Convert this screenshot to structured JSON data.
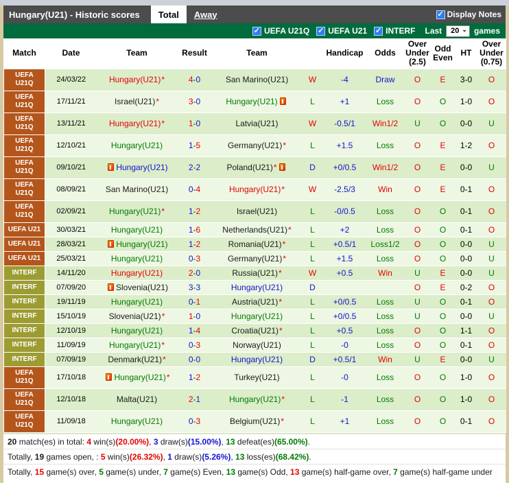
{
  "header": {
    "title": "Hungary(U21) - Historic scores",
    "tabs": [
      {
        "label": "Total",
        "active": true
      },
      {
        "label": "Away",
        "active": false
      }
    ],
    "display_notes_label": "Display Notes",
    "display_notes_checked": true
  },
  "filter_bar": {
    "checkboxes": [
      {
        "label": "UEFA U21Q",
        "checked": true
      },
      {
        "label": "UEFA U21",
        "checked": true
      },
      {
        "label": "INTERF",
        "checked": true
      }
    ],
    "last_label": "Last",
    "games_count": "20",
    "games_label": "games"
  },
  "colors": {
    "win_red": "#e60000",
    "loss_green": "#007a00",
    "draw_blue": "#1414cc",
    "uefa_label_bg": "#b4561c",
    "interf_label_bg": "#9c9c33",
    "filter_bar_green": "#006b3c",
    "title_bar_gray": "#4c4c4c"
  },
  "table": {
    "columns": [
      "Match",
      "Date",
      "Team",
      "Result",
      "Team",
      "",
      "Handicap",
      "Odds",
      "Over Under (2.5)",
      "Odd Even",
      "HT",
      "Over Under (0.75)"
    ],
    "rows": [
      {
        "comp": "UEFA U21Q",
        "type": "uefaq",
        "date": "24/03/22",
        "t1": {
          "n": "Hungary(U21)",
          "c": "red",
          "star": true,
          "note": ""
        },
        "s1": "4",
        "c1": "red",
        "s2": "0",
        "c2": "blue",
        "t2": {
          "n": "San Marino(U21)",
          "c": "black",
          "star": false,
          "note": ""
        },
        "wld": "W",
        "wldc": "red",
        "hc": "-4",
        "odds": "Draw",
        "oddsc": "blue",
        "ou": "O",
        "ouc": "red",
        "oe": "E",
        "oec": "red",
        "ht": "3-0",
        "ou75": "O",
        "ou75c": "red"
      },
      {
        "comp": "UEFA U21Q",
        "type": "uefaq",
        "date": "17/11/21",
        "t1": {
          "n": "Israel(U21)",
          "c": "black",
          "star": true,
          "note": ""
        },
        "s1": "3",
        "c1": "red",
        "s2": "0",
        "c2": "blue",
        "t2": {
          "n": "Hungary(U21)",
          "c": "green",
          "star": false,
          "note": "after"
        },
        "wld": "L",
        "wldc": "green",
        "hc": "+1",
        "odds": "Loss",
        "oddsc": "green",
        "ou": "O",
        "ouc": "red",
        "oe": "O",
        "oec": "green",
        "ht": "1-0",
        "ou75": "O",
        "ou75c": "red"
      },
      {
        "comp": "UEFA U21Q",
        "type": "uefaq",
        "date": "13/11/21",
        "t1": {
          "n": "Hungary(U21)",
          "c": "red",
          "star": true,
          "note": ""
        },
        "s1": "1",
        "c1": "red",
        "s2": "0",
        "c2": "blue",
        "t2": {
          "n": "Latvia(U21)",
          "c": "black",
          "star": false,
          "note": ""
        },
        "wld": "W",
        "wldc": "red",
        "hc": "-0.5/1",
        "odds": "Win1/2",
        "oddsc": "red",
        "ou": "U",
        "ouc": "green",
        "oe": "O",
        "oec": "green",
        "ht": "0-0",
        "ou75": "U",
        "ou75c": "green"
      },
      {
        "comp": "UEFA U21Q",
        "type": "uefaq",
        "date": "12/10/21",
        "t1": {
          "n": "Hungary(U21)",
          "c": "green",
          "star": false,
          "note": ""
        },
        "s1": "1",
        "c1": "blue",
        "s2": "5",
        "c2": "red",
        "t2": {
          "n": "Germany(U21)",
          "c": "black",
          "star": true,
          "note": ""
        },
        "wld": "L",
        "wldc": "green",
        "hc": "+1.5",
        "odds": "Loss",
        "oddsc": "green",
        "ou": "O",
        "ouc": "red",
        "oe": "E",
        "oec": "red",
        "ht": "1-2",
        "ou75": "O",
        "ou75c": "red"
      },
      {
        "comp": "UEFA U21Q",
        "type": "uefaq",
        "date": "09/10/21",
        "t1": {
          "n": "Hungary(U21)",
          "c": "blue",
          "star": false,
          "note": "before"
        },
        "s1": "2",
        "c1": "blue",
        "s2": "2",
        "c2": "blue",
        "t2": {
          "n": "Poland(U21)",
          "c": "black",
          "star": true,
          "note": "after"
        },
        "wld": "D",
        "wldc": "blue",
        "hc": "+0/0.5",
        "odds": "Win1/2",
        "oddsc": "red",
        "ou": "O",
        "ouc": "red",
        "oe": "E",
        "oec": "red",
        "ht": "0-0",
        "ou75": "U",
        "ou75c": "green"
      },
      {
        "comp": "UEFA U21Q",
        "type": "uefaq",
        "date": "08/09/21",
        "t1": {
          "n": "San Marino(U21)",
          "c": "black",
          "star": false,
          "note": ""
        },
        "s1": "0",
        "c1": "blue",
        "s2": "4",
        "c2": "red",
        "t2": {
          "n": "Hungary(U21)",
          "c": "red",
          "star": true,
          "note": ""
        },
        "wld": "W",
        "wldc": "red",
        "hc": "-2.5/3",
        "odds": "Win",
        "oddsc": "red",
        "ou": "O",
        "ouc": "red",
        "oe": "E",
        "oec": "red",
        "ht": "0-1",
        "ou75": "O",
        "ou75c": "red"
      },
      {
        "comp": "UEFA U21Q",
        "type": "uefaq",
        "date": "02/09/21",
        "t1": {
          "n": "Hungary(U21)",
          "c": "green",
          "star": true,
          "note": ""
        },
        "s1": "1",
        "c1": "blue",
        "s2": "2",
        "c2": "red",
        "t2": {
          "n": "Israel(U21)",
          "c": "black",
          "star": false,
          "note": ""
        },
        "wld": "L",
        "wldc": "green",
        "hc": "-0/0.5",
        "odds": "Loss",
        "oddsc": "green",
        "ou": "O",
        "ouc": "red",
        "oe": "O",
        "oec": "green",
        "ht": "0-1",
        "ou75": "O",
        "ou75c": "red"
      },
      {
        "comp": "UEFA U21",
        "type": "u21",
        "date": "30/03/21",
        "t1": {
          "n": "Hungary(U21)",
          "c": "green",
          "star": false,
          "note": ""
        },
        "s1": "1",
        "c1": "blue",
        "s2": "6",
        "c2": "red",
        "t2": {
          "n": "Netherlands(U21)",
          "c": "black",
          "star": true,
          "note": ""
        },
        "wld": "L",
        "wldc": "green",
        "hc": "+2",
        "odds": "Loss",
        "oddsc": "green",
        "ou": "O",
        "ouc": "red",
        "oe": "O",
        "oec": "green",
        "ht": "0-1",
        "ou75": "O",
        "ou75c": "red"
      },
      {
        "comp": "UEFA U21",
        "type": "u21",
        "date": "28/03/21",
        "t1": {
          "n": "Hungary(U21)",
          "c": "green",
          "star": false,
          "note": "before"
        },
        "s1": "1",
        "c1": "blue",
        "s2": "2",
        "c2": "red",
        "t2": {
          "n": "Romania(U21)",
          "c": "black",
          "star": true,
          "note": ""
        },
        "wld": "L",
        "wldc": "green",
        "hc": "+0.5/1",
        "odds": "Loss1/2",
        "oddsc": "green",
        "ou": "O",
        "ouc": "red",
        "oe": "O",
        "oec": "green",
        "ht": "0-0",
        "ou75": "U",
        "ou75c": "green"
      },
      {
        "comp": "UEFA U21",
        "type": "u21",
        "date": "25/03/21",
        "t1": {
          "n": "Hungary(U21)",
          "c": "green",
          "star": false,
          "note": ""
        },
        "s1": "0",
        "c1": "blue",
        "s2": "3",
        "c2": "red",
        "t2": {
          "n": "Germany(U21)",
          "c": "black",
          "star": true,
          "note": ""
        },
        "wld": "L",
        "wldc": "green",
        "hc": "+1.5",
        "odds": "Loss",
        "oddsc": "green",
        "ou": "O",
        "ouc": "red",
        "oe": "O",
        "oec": "green",
        "ht": "0-0",
        "ou75": "U",
        "ou75c": "green"
      },
      {
        "comp": "INTERF",
        "type": "interf",
        "date": "14/11/20",
        "t1": {
          "n": "Hungary(U21)",
          "c": "red",
          "star": false,
          "note": ""
        },
        "s1": "2",
        "c1": "red",
        "s2": "0",
        "c2": "blue",
        "t2": {
          "n": "Russia(U21)",
          "c": "black",
          "star": true,
          "note": ""
        },
        "wld": "W",
        "wldc": "red",
        "hc": "+0.5",
        "odds": "Win",
        "oddsc": "red",
        "ou": "U",
        "ouc": "green",
        "oe": "E",
        "oec": "red",
        "ht": "0-0",
        "ou75": "U",
        "ou75c": "green"
      },
      {
        "comp": "INTERF",
        "type": "interf",
        "date": "07/09/20",
        "t1": {
          "n": "Slovenia(U21)",
          "c": "black",
          "star": false,
          "note": "before"
        },
        "s1": "3",
        "c1": "blue",
        "s2": "3",
        "c2": "blue",
        "t2": {
          "n": "Hungary(U21)",
          "c": "blue",
          "star": false,
          "note": ""
        },
        "wld": "D",
        "wldc": "blue",
        "hc": "",
        "odds": "",
        "oddsc": "black",
        "ou": "O",
        "ouc": "red",
        "oe": "E",
        "oec": "red",
        "ht": "0-2",
        "ou75": "O",
        "ou75c": "red"
      },
      {
        "comp": "INTERF",
        "type": "interf",
        "date": "19/11/19",
        "t1": {
          "n": "Hungary(U21)",
          "c": "green",
          "star": false,
          "note": ""
        },
        "s1": "0",
        "c1": "blue",
        "s2": "1",
        "c2": "red",
        "t2": {
          "n": "Austria(U21)",
          "c": "black",
          "star": true,
          "note": ""
        },
        "wld": "L",
        "wldc": "green",
        "hc": "+0/0.5",
        "odds": "Loss",
        "oddsc": "green",
        "ou": "U",
        "ouc": "green",
        "oe": "O",
        "oec": "green",
        "ht": "0-1",
        "ou75": "O",
        "ou75c": "red"
      },
      {
        "comp": "INTERF",
        "type": "interf",
        "date": "15/10/19",
        "t1": {
          "n": "Slovenia(U21)",
          "c": "black",
          "star": true,
          "note": ""
        },
        "s1": "1",
        "c1": "red",
        "s2": "0",
        "c2": "blue",
        "t2": {
          "n": "Hungary(U21)",
          "c": "green",
          "star": false,
          "note": ""
        },
        "wld": "L",
        "wldc": "green",
        "hc": "+0/0.5",
        "odds": "Loss",
        "oddsc": "green",
        "ou": "U",
        "ouc": "green",
        "oe": "O",
        "oec": "green",
        "ht": "0-0",
        "ou75": "U",
        "ou75c": "green"
      },
      {
        "comp": "INTERF",
        "type": "interf",
        "date": "12/10/19",
        "t1": {
          "n": "Hungary(U21)",
          "c": "green",
          "star": false,
          "note": ""
        },
        "s1": "1",
        "c1": "blue",
        "s2": "4",
        "c2": "red",
        "t2": {
          "n": "Croatia(U21)",
          "c": "black",
          "star": true,
          "note": ""
        },
        "wld": "L",
        "wldc": "green",
        "hc": "+0.5",
        "odds": "Loss",
        "oddsc": "green",
        "ou": "O",
        "ouc": "red",
        "oe": "O",
        "oec": "green",
        "ht": "1-1",
        "ou75": "O",
        "ou75c": "red"
      },
      {
        "comp": "INTERF",
        "type": "interf",
        "date": "11/09/19",
        "t1": {
          "n": "Hungary(U21)",
          "c": "green",
          "star": true,
          "note": ""
        },
        "s1": "0",
        "c1": "blue",
        "s2": "3",
        "c2": "red",
        "t2": {
          "n": "Norway(U21)",
          "c": "black",
          "star": false,
          "note": ""
        },
        "wld": "L",
        "wldc": "green",
        "hc": "-0",
        "odds": "Loss",
        "oddsc": "green",
        "ou": "O",
        "ouc": "red",
        "oe": "O",
        "oec": "green",
        "ht": "0-1",
        "ou75": "O",
        "ou75c": "red"
      },
      {
        "comp": "INTERF",
        "type": "interf",
        "date": "07/09/19",
        "t1": {
          "n": "Denmark(U21)",
          "c": "black",
          "star": true,
          "note": ""
        },
        "s1": "0",
        "c1": "blue",
        "s2": "0",
        "c2": "blue",
        "t2": {
          "n": "Hungary(U21)",
          "c": "blue",
          "star": false,
          "note": ""
        },
        "wld": "D",
        "wldc": "blue",
        "hc": "+0.5/1",
        "odds": "Win",
        "oddsc": "red",
        "ou": "U",
        "ouc": "green",
        "oe": "E",
        "oec": "red",
        "ht": "0-0",
        "ou75": "U",
        "ou75c": "green"
      },
      {
        "comp": "UEFA U21Q",
        "type": "uefaq",
        "date": "17/10/18",
        "t1": {
          "n": "Hungary(U21)",
          "c": "green",
          "star": true,
          "note": "before"
        },
        "s1": "1",
        "c1": "blue",
        "s2": "2",
        "c2": "red",
        "t2": {
          "n": "Turkey(U21)",
          "c": "black",
          "star": false,
          "note": ""
        },
        "wld": "L",
        "wldc": "green",
        "hc": "-0",
        "odds": "Loss",
        "oddsc": "green",
        "ou": "O",
        "ouc": "red",
        "oe": "O",
        "oec": "green",
        "ht": "1-0",
        "ou75": "O",
        "ou75c": "red"
      },
      {
        "comp": "UEFA U21Q",
        "type": "uefaq",
        "date": "12/10/18",
        "t1": {
          "n": "Malta(U21)",
          "c": "black",
          "star": false,
          "note": ""
        },
        "s1": "2",
        "c1": "red",
        "s2": "1",
        "c2": "blue",
        "t2": {
          "n": "Hungary(U21)",
          "c": "green",
          "star": true,
          "note": ""
        },
        "wld": "L",
        "wldc": "green",
        "hc": "-1",
        "odds": "Loss",
        "oddsc": "green",
        "ou": "O",
        "ouc": "red",
        "oe": "O",
        "oec": "green",
        "ht": "1-0",
        "ou75": "O",
        "ou75c": "red"
      },
      {
        "comp": "UEFA U21Q",
        "type": "uefaq",
        "date": "11/09/18",
        "t1": {
          "n": "Hungary(U21)",
          "c": "green",
          "star": false,
          "note": ""
        },
        "s1": "0",
        "c1": "blue",
        "s2": "3",
        "c2": "red",
        "t2": {
          "n": "Belgium(U21)",
          "c": "black",
          "star": true,
          "note": ""
        },
        "wld": "L",
        "wldc": "green",
        "hc": "+1",
        "odds": "Loss",
        "oddsc": "green",
        "ou": "O",
        "ouc": "red",
        "oe": "O",
        "oec": "green",
        "ht": "0-1",
        "ou75": "O",
        "ou75c": "red"
      }
    ]
  },
  "footer": {
    "lines": [
      [
        {
          "t": "20",
          "b": 1
        },
        {
          "t": " match(es) in total: "
        },
        {
          "t": "4",
          "c": "red",
          "b": 1
        },
        {
          "t": " win(s)"
        },
        {
          "t": "(20.00%)",
          "c": "red",
          "b": 1
        },
        {
          "t": ", "
        },
        {
          "t": "3",
          "c": "blue",
          "b": 1
        },
        {
          "t": " draw(s)"
        },
        {
          "t": "(15.00%)",
          "c": "blue",
          "b": 1
        },
        {
          "t": ", "
        },
        {
          "t": "13",
          "c": "green",
          "b": 1
        },
        {
          "t": " defeat(es)"
        },
        {
          "t": "(65.00%)",
          "c": "green",
          "b": 1
        },
        {
          "t": "."
        }
      ],
      [
        {
          "t": "Totally, "
        },
        {
          "t": "19",
          "b": 1
        },
        {
          "t": " games open, : "
        },
        {
          "t": "5",
          "c": "red",
          "b": 1
        },
        {
          "t": " win(s)"
        },
        {
          "t": "(26.32%)",
          "c": "red",
          "b": 1
        },
        {
          "t": ", "
        },
        {
          "t": "1",
          "c": "blue",
          "b": 1
        },
        {
          "t": " draw(s)"
        },
        {
          "t": "(5.26%)",
          "c": "blue",
          "b": 1
        },
        {
          "t": ", "
        },
        {
          "t": "13",
          "c": "green",
          "b": 1
        },
        {
          "t": " loss(es)"
        },
        {
          "t": "(68.42%)",
          "c": "green",
          "b": 1
        },
        {
          "t": "."
        }
      ],
      [
        {
          "t": "Totally, "
        },
        {
          "t": "15",
          "c": "red",
          "b": 1
        },
        {
          "t": " game(s) over, "
        },
        {
          "t": "5",
          "c": "green",
          "b": 1
        },
        {
          "t": " game(s) under, "
        },
        {
          "t": "7",
          "c": "green",
          "b": 1
        },
        {
          "t": " game(s) Even, "
        },
        {
          "t": "13",
          "c": "green",
          "b": 1
        },
        {
          "t": " game(s) Odd, "
        },
        {
          "t": "13",
          "c": "red",
          "b": 1
        },
        {
          "t": " game(s) half-game over, "
        },
        {
          "t": "7",
          "c": "green",
          "b": 1
        },
        {
          "t": " game(s) half-game under"
        }
      ]
    ]
  }
}
